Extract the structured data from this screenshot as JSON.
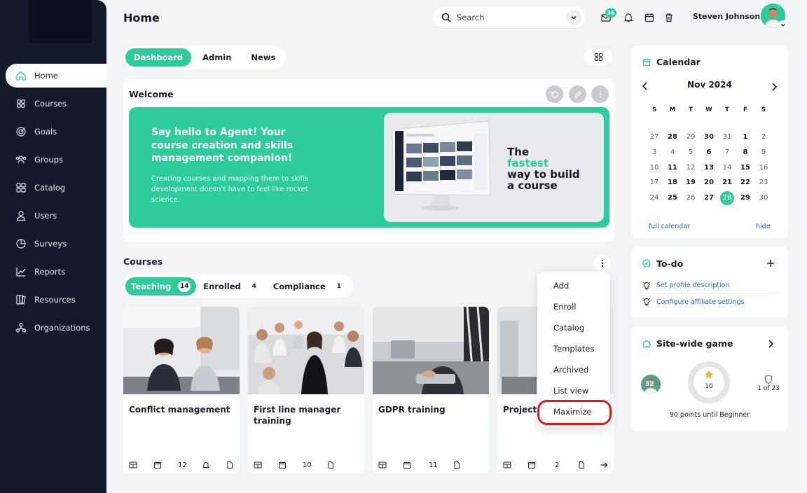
{
  "header": {
    "title": "Home",
    "search_placeholder": "Search",
    "notif_count": "36",
    "user_name": "Steven Johnson"
  },
  "sidebar": {
    "items": [
      {
        "label": "Home",
        "icon": "home-icon"
      },
      {
        "label": "Courses",
        "icon": "courses-icon"
      },
      {
        "label": "Goals",
        "icon": "goals-icon"
      },
      {
        "label": "Groups",
        "icon": "groups-icon"
      },
      {
        "label": "Catalog",
        "icon": "catalog-icon"
      },
      {
        "label": "Users",
        "icon": "users-icon"
      },
      {
        "label": "Surveys",
        "icon": "surveys-icon"
      },
      {
        "label": "Reports",
        "icon": "reports-icon"
      },
      {
        "label": "Resources",
        "icon": "resources-icon"
      },
      {
        "label": "Organizations",
        "icon": "organizations-icon"
      }
    ]
  },
  "tabs": [
    "Dashboard",
    "Admin",
    "News"
  ],
  "welcome": {
    "title": "Welcome",
    "headline": "Say hello to Agent! Your course creation and skills management companion!",
    "subtext": "Creating courses and mapping them to skills development doesn’t have to feel like rocket science.",
    "tagline_1": "The",
    "tagline_accent": "fastest",
    "tagline_2": "way to build",
    "tagline_3": "a course"
  },
  "courses": {
    "title": "Courses",
    "tabs": [
      {
        "label": "Teaching",
        "count": "14"
      },
      {
        "label": "Enrolled",
        "count": "4"
      },
      {
        "label": "Compliance",
        "count": "1"
      }
    ],
    "cards": [
      {
        "title": "Conflict management",
        "count": "12"
      },
      {
        "title": "First line manager training",
        "count": "10"
      },
      {
        "title": "GDPR training",
        "count": "11"
      },
      {
        "title": "Project",
        "count": "2"
      }
    ],
    "menu": [
      "Add",
      "Enroll",
      "Catalog",
      "Templates",
      "Archived",
      "List view",
      "Maximize"
    ]
  },
  "calendar": {
    "title": "Calendar",
    "month": "Nov 2024",
    "dow": [
      "S",
      "M",
      "T",
      "W",
      "T",
      "F",
      "S"
    ],
    "weeks": [
      [
        "27",
        "28",
        "29",
        "30",
        "31",
        "1",
        "2"
      ],
      [
        "3",
        "4",
        "5",
        "6",
        "7",
        "8",
        "9"
      ],
      [
        "10",
        "11",
        "12",
        "13",
        "14",
        "15",
        "16"
      ],
      [
        "17",
        "18",
        "19",
        "20",
        "21",
        "22",
        "23"
      ],
      [
        "24",
        "25",
        "26",
        "27",
        "28",
        "29",
        "30"
      ]
    ],
    "full_link": "full calendar",
    "hide_link": "hide"
  },
  "todo": {
    "title": "To-do",
    "items": [
      "Set profile description",
      "Configure affiliate settings"
    ]
  },
  "game": {
    "title": "Site-wide game",
    "level": "32",
    "points": "10",
    "rank": "1 of 23",
    "status": "90 points until Beginner"
  },
  "colors": {
    "accent": "#2ecb9c",
    "sidebar": "#131a2c",
    "link": "#2a66c8",
    "highlight": "#e21a1a"
  }
}
